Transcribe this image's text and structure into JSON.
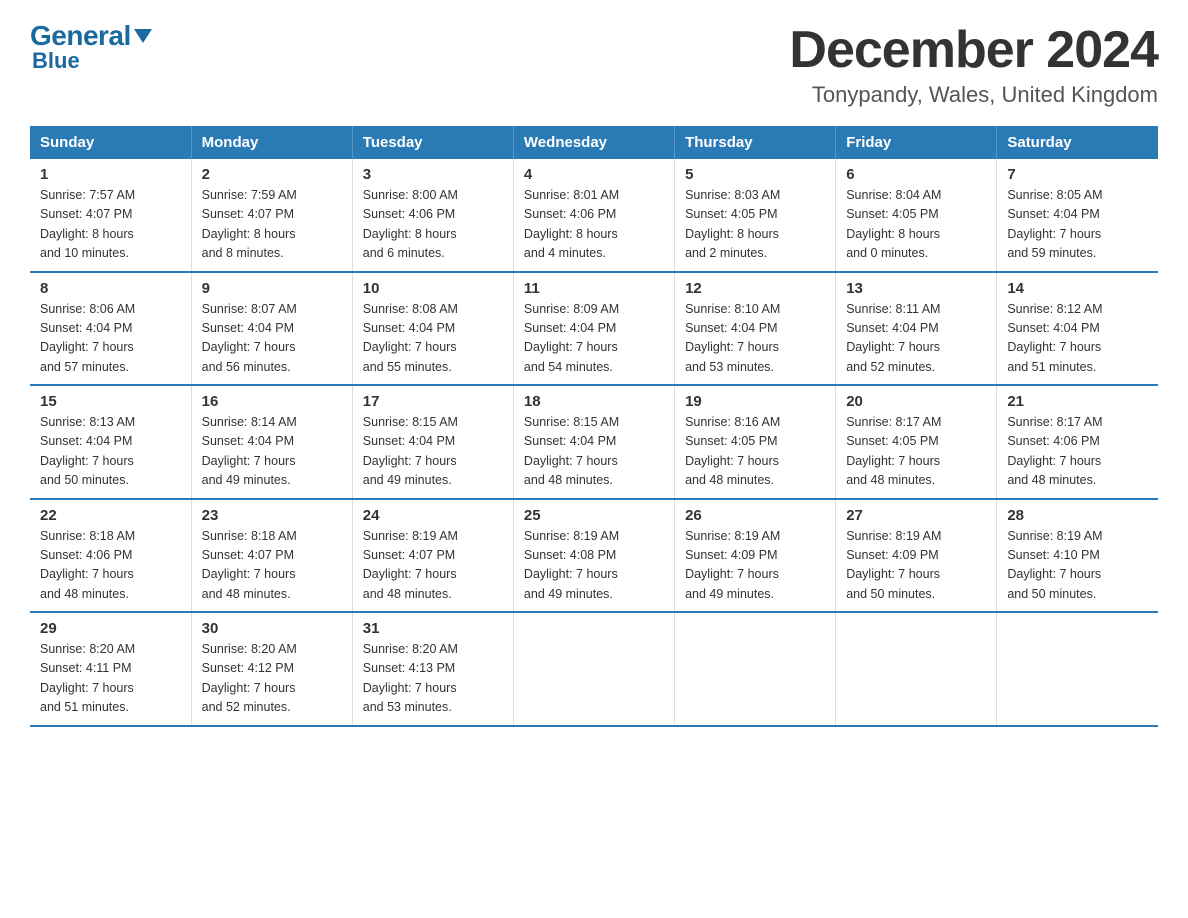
{
  "header": {
    "logo_general": "General",
    "logo_blue": "Blue",
    "title": "December 2024",
    "subtitle": "Tonypandy, Wales, United Kingdom"
  },
  "weekdays": [
    "Sunday",
    "Monday",
    "Tuesday",
    "Wednesday",
    "Thursday",
    "Friday",
    "Saturday"
  ],
  "weeks": [
    [
      {
        "day": "1",
        "info": "Sunrise: 7:57 AM\nSunset: 4:07 PM\nDaylight: 8 hours\nand 10 minutes."
      },
      {
        "day": "2",
        "info": "Sunrise: 7:59 AM\nSunset: 4:07 PM\nDaylight: 8 hours\nand 8 minutes."
      },
      {
        "day": "3",
        "info": "Sunrise: 8:00 AM\nSunset: 4:06 PM\nDaylight: 8 hours\nand 6 minutes."
      },
      {
        "day": "4",
        "info": "Sunrise: 8:01 AM\nSunset: 4:06 PM\nDaylight: 8 hours\nand 4 minutes."
      },
      {
        "day": "5",
        "info": "Sunrise: 8:03 AM\nSunset: 4:05 PM\nDaylight: 8 hours\nand 2 minutes."
      },
      {
        "day": "6",
        "info": "Sunrise: 8:04 AM\nSunset: 4:05 PM\nDaylight: 8 hours\nand 0 minutes."
      },
      {
        "day": "7",
        "info": "Sunrise: 8:05 AM\nSunset: 4:04 PM\nDaylight: 7 hours\nand 59 minutes."
      }
    ],
    [
      {
        "day": "8",
        "info": "Sunrise: 8:06 AM\nSunset: 4:04 PM\nDaylight: 7 hours\nand 57 minutes."
      },
      {
        "day": "9",
        "info": "Sunrise: 8:07 AM\nSunset: 4:04 PM\nDaylight: 7 hours\nand 56 minutes."
      },
      {
        "day": "10",
        "info": "Sunrise: 8:08 AM\nSunset: 4:04 PM\nDaylight: 7 hours\nand 55 minutes."
      },
      {
        "day": "11",
        "info": "Sunrise: 8:09 AM\nSunset: 4:04 PM\nDaylight: 7 hours\nand 54 minutes."
      },
      {
        "day": "12",
        "info": "Sunrise: 8:10 AM\nSunset: 4:04 PM\nDaylight: 7 hours\nand 53 minutes."
      },
      {
        "day": "13",
        "info": "Sunrise: 8:11 AM\nSunset: 4:04 PM\nDaylight: 7 hours\nand 52 minutes."
      },
      {
        "day": "14",
        "info": "Sunrise: 8:12 AM\nSunset: 4:04 PM\nDaylight: 7 hours\nand 51 minutes."
      }
    ],
    [
      {
        "day": "15",
        "info": "Sunrise: 8:13 AM\nSunset: 4:04 PM\nDaylight: 7 hours\nand 50 minutes."
      },
      {
        "day": "16",
        "info": "Sunrise: 8:14 AM\nSunset: 4:04 PM\nDaylight: 7 hours\nand 49 minutes."
      },
      {
        "day": "17",
        "info": "Sunrise: 8:15 AM\nSunset: 4:04 PM\nDaylight: 7 hours\nand 49 minutes."
      },
      {
        "day": "18",
        "info": "Sunrise: 8:15 AM\nSunset: 4:04 PM\nDaylight: 7 hours\nand 48 minutes."
      },
      {
        "day": "19",
        "info": "Sunrise: 8:16 AM\nSunset: 4:05 PM\nDaylight: 7 hours\nand 48 minutes."
      },
      {
        "day": "20",
        "info": "Sunrise: 8:17 AM\nSunset: 4:05 PM\nDaylight: 7 hours\nand 48 minutes."
      },
      {
        "day": "21",
        "info": "Sunrise: 8:17 AM\nSunset: 4:06 PM\nDaylight: 7 hours\nand 48 minutes."
      }
    ],
    [
      {
        "day": "22",
        "info": "Sunrise: 8:18 AM\nSunset: 4:06 PM\nDaylight: 7 hours\nand 48 minutes."
      },
      {
        "day": "23",
        "info": "Sunrise: 8:18 AM\nSunset: 4:07 PM\nDaylight: 7 hours\nand 48 minutes."
      },
      {
        "day": "24",
        "info": "Sunrise: 8:19 AM\nSunset: 4:07 PM\nDaylight: 7 hours\nand 48 minutes."
      },
      {
        "day": "25",
        "info": "Sunrise: 8:19 AM\nSunset: 4:08 PM\nDaylight: 7 hours\nand 49 minutes."
      },
      {
        "day": "26",
        "info": "Sunrise: 8:19 AM\nSunset: 4:09 PM\nDaylight: 7 hours\nand 49 minutes."
      },
      {
        "day": "27",
        "info": "Sunrise: 8:19 AM\nSunset: 4:09 PM\nDaylight: 7 hours\nand 50 minutes."
      },
      {
        "day": "28",
        "info": "Sunrise: 8:19 AM\nSunset: 4:10 PM\nDaylight: 7 hours\nand 50 minutes."
      }
    ],
    [
      {
        "day": "29",
        "info": "Sunrise: 8:20 AM\nSunset: 4:11 PM\nDaylight: 7 hours\nand 51 minutes."
      },
      {
        "day": "30",
        "info": "Sunrise: 8:20 AM\nSunset: 4:12 PM\nDaylight: 7 hours\nand 52 minutes."
      },
      {
        "day": "31",
        "info": "Sunrise: 8:20 AM\nSunset: 4:13 PM\nDaylight: 7 hours\nand 53 minutes."
      },
      {
        "day": "",
        "info": ""
      },
      {
        "day": "",
        "info": ""
      },
      {
        "day": "",
        "info": ""
      },
      {
        "day": "",
        "info": ""
      }
    ]
  ]
}
